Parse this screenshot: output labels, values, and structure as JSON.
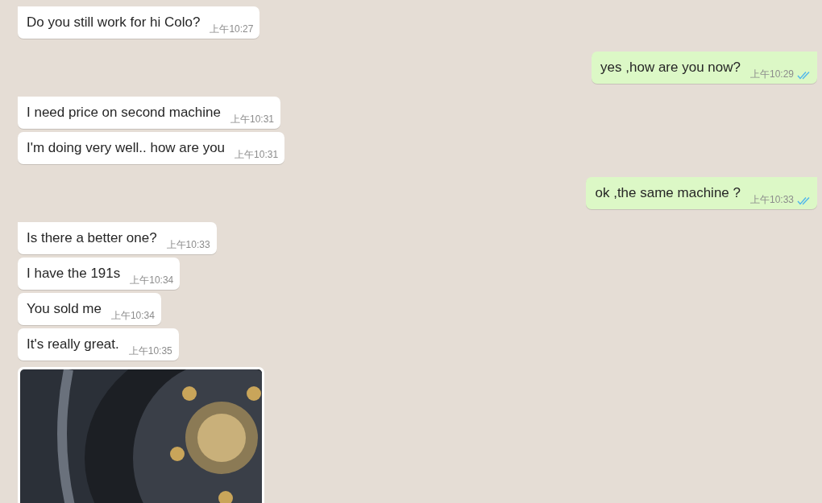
{
  "messages": [
    {
      "kind": "text",
      "outgoing": false,
      "tail": true,
      "text": "Do you still work for hi Colo?",
      "time": "上午10:27"
    },
    {
      "kind": "text",
      "outgoing": true,
      "tail": true,
      "text": "yes  ,how are you now?",
      "time": "上午10:29",
      "read": true
    },
    {
      "kind": "text",
      "outgoing": false,
      "tail": true,
      "text": "I need price on second machine",
      "time": "上午10:31"
    },
    {
      "kind": "text",
      "outgoing": false,
      "tail": false,
      "text": "I'm doing very well.. how are you",
      "time": "上午10:31"
    },
    {
      "kind": "text",
      "outgoing": true,
      "tail": true,
      "text": "ok ,the same machine ?",
      "time": "上午10:33",
      "read": true
    },
    {
      "kind": "text",
      "outgoing": false,
      "tail": true,
      "text": "Is there a better one?",
      "time": "上午10:33"
    },
    {
      "kind": "text",
      "outgoing": false,
      "tail": false,
      "text": "I have the 191s",
      "time": "上午10:34"
    },
    {
      "kind": "text",
      "outgoing": false,
      "tail": false,
      "text": "You sold me",
      "time": "上午10:34"
    },
    {
      "kind": "text",
      "outgoing": false,
      "tail": false,
      "text": "It's really great.",
      "time": "上午10:35"
    },
    {
      "kind": "image",
      "outgoing": false
    }
  ]
}
